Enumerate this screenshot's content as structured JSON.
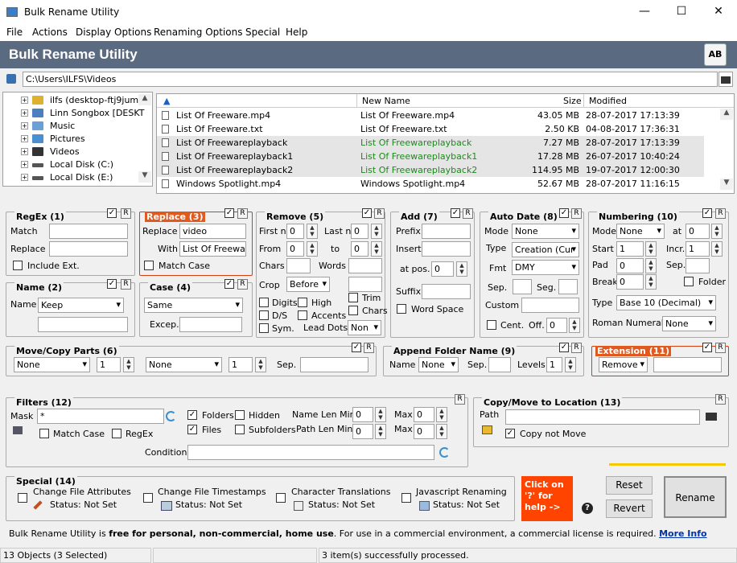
{
  "window": {
    "title": "Bulk Rename Utility",
    "min": "—",
    "max": "☐",
    "close": "✕"
  },
  "menu": [
    "File",
    "Actions",
    "Display Options",
    "Renaming Options",
    "Special",
    "Help"
  ],
  "banner": {
    "title": "Bulk Rename Utility",
    "logo": "AB"
  },
  "path": {
    "value": "C:\\Users\\ILFS\\Videos"
  },
  "tree": [
    {
      "label": "ilfs (desktop-ftj9jum)",
      "color": "#e0b030"
    },
    {
      "label": "Linn Songbox [DESKT",
      "color": "#4a7fc0"
    },
    {
      "label": "Music",
      "color": "#6a9fd8"
    },
    {
      "label": "Pictures",
      "color": "#4a8fd0"
    },
    {
      "label": "Videos",
      "color": "#333"
    },
    {
      "label": "Local Disk (C:)",
      "color": "#555"
    },
    {
      "label": "Local Disk (E:)",
      "color": "#555"
    }
  ],
  "list": {
    "columns": [
      "",
      "New Name",
      "Size",
      "Modified"
    ],
    "rows": [
      {
        "name": "List Of Freeware.mp4",
        "new": "List Of Freeware.mp4",
        "size": "43.05 MB",
        "mod": "28-07-2017 17:13:39",
        "sel": false,
        "changed": false
      },
      {
        "name": "List Of Freeware.txt",
        "new": "List Of Freeware.txt",
        "size": "2.50 KB",
        "mod": "04-08-2017 17:36:31",
        "sel": false,
        "changed": false
      },
      {
        "name": "List Of Freewareplayback",
        "new": "List Of Freewareplayback",
        "size": "7.27 MB",
        "mod": "28-07-2017 17:13:39",
        "sel": true,
        "changed": true
      },
      {
        "name": "List Of Freewareplayback1",
        "new": "List Of Freewareplayback1",
        "size": "17.28 MB",
        "mod": "26-07-2017 10:40:24",
        "sel": true,
        "changed": true
      },
      {
        "name": "List Of Freewareplayback2",
        "new": "List Of Freewareplayback2",
        "size": "114.95 MB",
        "mod": "19-07-2017 12:00:30",
        "sel": true,
        "changed": true
      },
      {
        "name": "Windows Spotlight.mp4",
        "new": "Windows Spotlight.mp4",
        "size": "52.67 MB",
        "mod": "28-07-2017 11:16:15",
        "sel": false,
        "changed": false
      }
    ]
  },
  "regex": {
    "title": "RegEx (1)",
    "match": "Match",
    "replace": "Replace",
    "include": "Include Ext."
  },
  "replace": {
    "title": "Replace (3)",
    "replace_lbl": "Replace",
    "replace_val": "video",
    "with_lbl": "With",
    "with_val": "List Of Freeware",
    "matchcase": "Match Case"
  },
  "remove": {
    "title": "Remove (5)",
    "firstn": "First n",
    "lastn": "Last n",
    "from": "From",
    "to": "to",
    "chars": "Chars",
    "words": "Words",
    "crop": "Crop",
    "crop_val": "Before",
    "digits": "Digits",
    "high": "High",
    "trim": "Trim",
    "ds": "D/S",
    "accents": "Accents",
    "charsck": "Chars",
    "sym": "Sym.",
    "leaddots": "Lead Dots",
    "lead_val": "Non",
    "v0": "0"
  },
  "add": {
    "title": "Add (7)",
    "prefix": "Prefix",
    "insert": "Insert",
    "atpos": "at pos.",
    "atpos_val": "0",
    "suffix": "Suffix",
    "wordspace": "Word Space"
  },
  "autodate": {
    "title": "Auto Date (8)",
    "mode": "Mode",
    "mode_val": "None",
    "type": "Type",
    "type_val": "Creation (Cur",
    "fmt": "Fmt",
    "fmt_val": "DMY",
    "sep": "Sep.",
    "seg": "Seg.",
    "custom": "Custom",
    "cent": "Cent.",
    "off": "Off.",
    "off_val": "0"
  },
  "numbering": {
    "title": "Numbering (10)",
    "mode": "Mode",
    "mode_val": "None",
    "at": "at",
    "at_val": "0",
    "start": "Start",
    "start_val": "1",
    "incr": "Incr.",
    "incr_val": "1",
    "pad": "Pad",
    "pad_val": "0",
    "sep": "Sep.",
    "break": "Break",
    "break_val": "0",
    "folder": "Folder",
    "type": "Type",
    "type_val": "Base 10 (Decimal)",
    "roman": "Roman Numerals",
    "roman_val": "None"
  },
  "name": {
    "title": "Name (2)",
    "name_lbl": "Name",
    "name_val": "Keep"
  },
  "case": {
    "title": "Case (4)",
    "case_val": "Same",
    "excep": "Excep."
  },
  "movecopy": {
    "title": "Move/Copy Parts (6)",
    "v1": "None",
    "n1": "1",
    "v2": "None",
    "n2": "1",
    "sep": "Sep."
  },
  "appendfolder": {
    "title": "Append Folder Name (9)",
    "name": "Name",
    "name_val": "None",
    "sep": "Sep.",
    "levels": "Levels",
    "levels_val": "1"
  },
  "extension": {
    "title": "Extension (11)",
    "val": "Remove"
  },
  "filters": {
    "title": "Filters (12)",
    "mask": "Mask",
    "mask_val": "*",
    "folders": "Folders",
    "hidden": "Hidden",
    "files": "Files",
    "subfolders": "Subfolders",
    "matchcase": "Match Case",
    "regex": "RegEx",
    "namelenmin": "Name Len Min",
    "pathlenmin": "Path Len Min",
    "max": "Max",
    "condition": "Condition",
    "v0": "0"
  },
  "copymove": {
    "title": "Copy/Move to Location (13)",
    "path": "Path",
    "copynotmove": "Copy not Move"
  },
  "special": {
    "title": "Special (14)",
    "items": [
      {
        "label": "Change File Attributes",
        "status": "Status: Not Set"
      },
      {
        "label": "Change File Timestamps",
        "status": "Status: Not Set"
      },
      {
        "label": "Character Translations",
        "status": "Status: Not Set"
      },
      {
        "label": "Javascript Renaming",
        "status": "Status: Not Set"
      }
    ]
  },
  "help": {
    "text": "Click on '?' for help ->",
    "q": "?"
  },
  "buttons": {
    "reset": "Reset",
    "revert": "Revert",
    "rename": "Rename",
    "r": "R"
  },
  "footer": {
    "pre": "Bulk Rename Utility is ",
    "bold": "free for personal, non-commercial, home use",
    "post": ". For use in a commercial environment, a commercial license is required. ",
    "link": "More Info"
  },
  "status": {
    "objects": "13 Objects (3 Selected)",
    "processed": "3 item(s) successfully processed."
  },
  "colors": {
    "banner": "#5a6a80",
    "accent": "#e05a20",
    "rename_bar": "#f5c800"
  }
}
